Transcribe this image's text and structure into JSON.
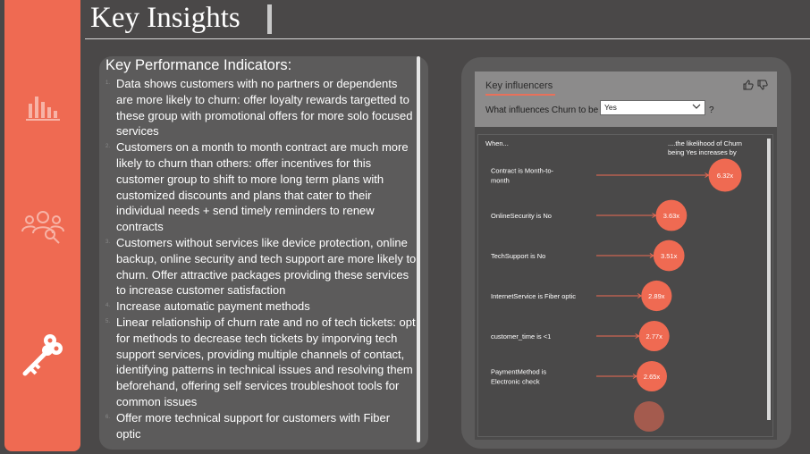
{
  "nav": {
    "items": [
      {
        "icon": "bar-chart-icon",
        "active": false
      },
      {
        "icon": "user-group-search-icon",
        "active": false
      },
      {
        "icon": "key-icon",
        "active": true
      }
    ]
  },
  "header": {
    "title": "Key Insights"
  },
  "kpi": {
    "heading": "Key Performance Indicators:",
    "items": [
      {
        "num": "1.",
        "text": "Data shows customers with no partners or dependents are more likely to churn: offer loyalty rewards targetted to these group with promotional offers for more solo focused services"
      },
      {
        "num": "2.",
        "text": "Customers on a month to month contract are much more likely to churn than others: offer incentives for this customer group to shift to more long term plans with customized discounts and plans that cater to their individual needs + send timely reminders to renew contracts"
      },
      {
        "num": "3.",
        "text": "Customers without services like device protection, online backup, online security and tech support are more likely to churn. Offer attractive packages providing these services to increase customer satisfaction"
      },
      {
        "num": "4.",
        "text": "Increase automatic payment methods"
      },
      {
        "num": "5.",
        "text": "Linear relationship of churn rate and no of tech tickets: opt for methods to decrease tech tickets by imporving tech support services, providing multiple channels of contact, identifying patterns in technical issues and resolving them beforehand, offering self services troubleshoot tools for common issues"
      },
      {
        "num": "6.",
        "text": "Offer more technical support for customers with Fiber optic"
      }
    ]
  },
  "key_influencers": {
    "tab_label": "Key influencers",
    "question": "What influences Churn to be",
    "selected_value": "Yes",
    "help": "?",
    "when_label": "When...",
    "likelihood_label_1": "....the likelihood of Churn",
    "likelihood_label_2": "being Yes increases by",
    "accent_color": "#ef6a52",
    "rows": [
      {
        "lines": [
          "Contract is Month-to-",
          "month"
        ],
        "factor": 6.32,
        "label": "6.32x"
      },
      {
        "lines": [
          "OnlineSecurity is No"
        ],
        "factor": 3.63,
        "label": "3.63x"
      },
      {
        "lines": [
          "TechSupport is No"
        ],
        "factor": 3.51,
        "label": "3.51x"
      },
      {
        "lines": [
          "InternetService is Fiber optic"
        ],
        "factor": 2.89,
        "label": "2.89x"
      },
      {
        "lines": [
          "customer_time is <1"
        ],
        "factor": 2.77,
        "label": "2.77x"
      },
      {
        "lines": [
          "PaymentMethod is",
          "Electronic check"
        ],
        "factor": 2.65,
        "label": "2.65x"
      }
    ]
  }
}
